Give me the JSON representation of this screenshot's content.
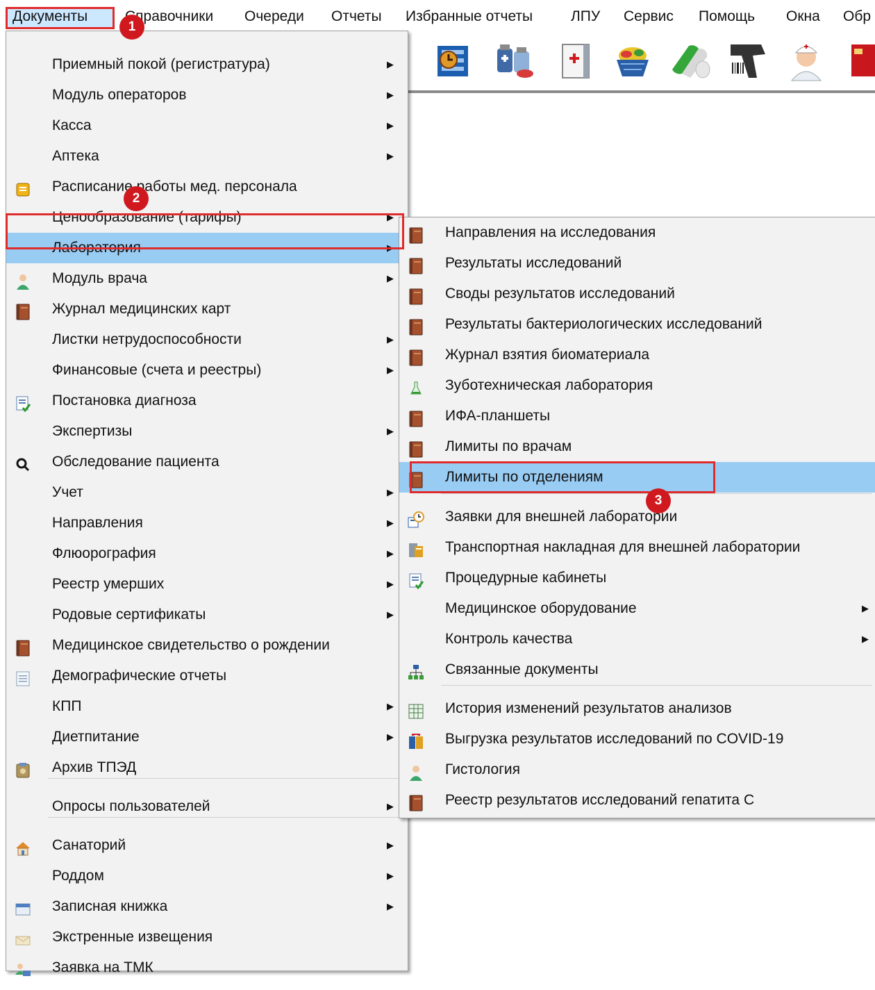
{
  "menubar": {
    "items": [
      "Документы",
      "Справочники",
      "Очереди",
      "Отчеты",
      "Избранные отчеты",
      "ЛПУ",
      "Сервис",
      "Помощь",
      "Окна",
      "Обр"
    ]
  },
  "toolbar": {
    "icons": [
      "document-clock-icon",
      "medicine-bottles-icon",
      "medical-book-icon",
      "pills-basket-icon",
      "capsule-icon",
      "barcode-scanner-icon",
      "nurse-icon",
      "red-folder-icon"
    ]
  },
  "main_menu": {
    "items": [
      {
        "label": "Приемный покой (регистратура)",
        "icon": "",
        "submenu": true
      },
      {
        "label": "Модуль операторов",
        "icon": "",
        "submenu": true
      },
      {
        "label": "Касса",
        "icon": "",
        "submenu": true
      },
      {
        "label": "Аптека",
        "icon": "",
        "submenu": true
      },
      {
        "label": "Расписание работы мед. персонала",
        "icon": "schedule-icon",
        "submenu": false
      },
      {
        "label": "Ценообразование (тарифы)",
        "icon": "",
        "submenu": true
      },
      {
        "label": "Лаборатория",
        "icon": "",
        "submenu": true
      },
      {
        "label": "Модуль врача",
        "icon": "doctor-icon",
        "submenu": true
      },
      {
        "label": "Журнал медицинских карт",
        "icon": "book-icon",
        "submenu": false
      },
      {
        "label": "Листки нетрудоспособности",
        "icon": "",
        "submenu": true
      },
      {
        "label": "Финансовые (счета и реестры)",
        "icon": "",
        "submenu": true
      },
      {
        "label": "Постановка диагноза",
        "icon": "diagnosis-icon",
        "submenu": false
      },
      {
        "label": "Экспертизы",
        "icon": "",
        "submenu": true
      },
      {
        "label": "Обследование пациента",
        "icon": "magnifier-icon",
        "submenu": false
      },
      {
        "label": "Учет",
        "icon": "",
        "submenu": true
      },
      {
        "label": "Направления",
        "icon": "",
        "submenu": true
      },
      {
        "label": "Флюорография",
        "icon": "",
        "submenu": true
      },
      {
        "label": "Реестр умерших",
        "icon": "",
        "submenu": true
      },
      {
        "label": "Родовые сертификаты",
        "icon": "",
        "submenu": true
      },
      {
        "label": "Медицинское свидетельство о рождении",
        "icon": "book-icon",
        "submenu": false
      },
      {
        "label": "Демографические отчеты",
        "icon": "report-icon",
        "submenu": false
      },
      {
        "label": "КПП",
        "icon": "",
        "submenu": true
      },
      {
        "label": "Диетпитание",
        "icon": "",
        "submenu": true
      },
      {
        "label": "Архив ТПЭД",
        "icon": "archive-icon",
        "submenu": false
      },
      {
        "label": "Опросы пользователей",
        "icon": "",
        "submenu": true
      },
      {
        "label": "Санаторий",
        "icon": "house-icon",
        "submenu": true
      },
      {
        "label": "Роддом",
        "icon": "",
        "submenu": true
      },
      {
        "label": "Записная книжка",
        "icon": "notebook-icon",
        "submenu": true
      },
      {
        "label": "Экстренные извещения",
        "icon": "notice-icon",
        "submenu": false
      },
      {
        "label": "Заявка на ТМК",
        "icon": "tmk-icon",
        "submenu": false
      }
    ]
  },
  "sub_menu": {
    "items": [
      {
        "label": "Направления на исследования",
        "icon": "book-icon",
        "submenu": false
      },
      {
        "label": "Результаты исследований",
        "icon": "book-icon",
        "submenu": false
      },
      {
        "label": "Своды результатов исследований",
        "icon": "book-icon",
        "submenu": false
      },
      {
        "label": "Результаты бактериологических исследований",
        "icon": "book-icon",
        "submenu": false
      },
      {
        "label": "Журнал взятия биоматериала",
        "icon": "book-icon",
        "submenu": false
      },
      {
        "label": "Зуботехническая лаборатория",
        "icon": "flask-icon",
        "submenu": false
      },
      {
        "label": "ИФА-планшеты",
        "icon": "book-icon",
        "submenu": false
      },
      {
        "label": "Лимиты по врачам",
        "icon": "book-icon",
        "submenu": false
      },
      {
        "label": "Лимиты по отделениям",
        "icon": "book-icon",
        "submenu": false
      },
      {
        "label": "Заявки для внешней лаборатории",
        "icon": "request-icon",
        "submenu": false
      },
      {
        "label": "Транспортная накладная для внешней лаборатории",
        "icon": "waybill-icon",
        "submenu": false
      },
      {
        "label": "Процедурные кабинеты",
        "icon": "diagnosis-icon",
        "submenu": false
      },
      {
        "label": "Медицинское оборудование",
        "icon": "",
        "submenu": true
      },
      {
        "label": "Контроль качества",
        "icon": "",
        "submenu": true
      },
      {
        "label": "Связанные документы",
        "icon": "hierarchy-icon",
        "submenu": false
      },
      {
        "label": "История изменений результатов анализов",
        "icon": "table-icon",
        "submenu": false
      },
      {
        "label": "Выгрузка результатов исследований по COVID-19",
        "icon": "export-icon",
        "submenu": false
      },
      {
        "label": "Гистология",
        "icon": "doctor-icon",
        "submenu": false
      },
      {
        "label": "Реестр результатов исследований гепатита С",
        "icon": "book-icon",
        "submenu": false
      }
    ]
  },
  "badges": [
    "1",
    "2",
    "3"
  ],
  "colors": {
    "highlight": "#99ccf3",
    "frame": "#e02b2b",
    "badge": "#d0191f"
  }
}
